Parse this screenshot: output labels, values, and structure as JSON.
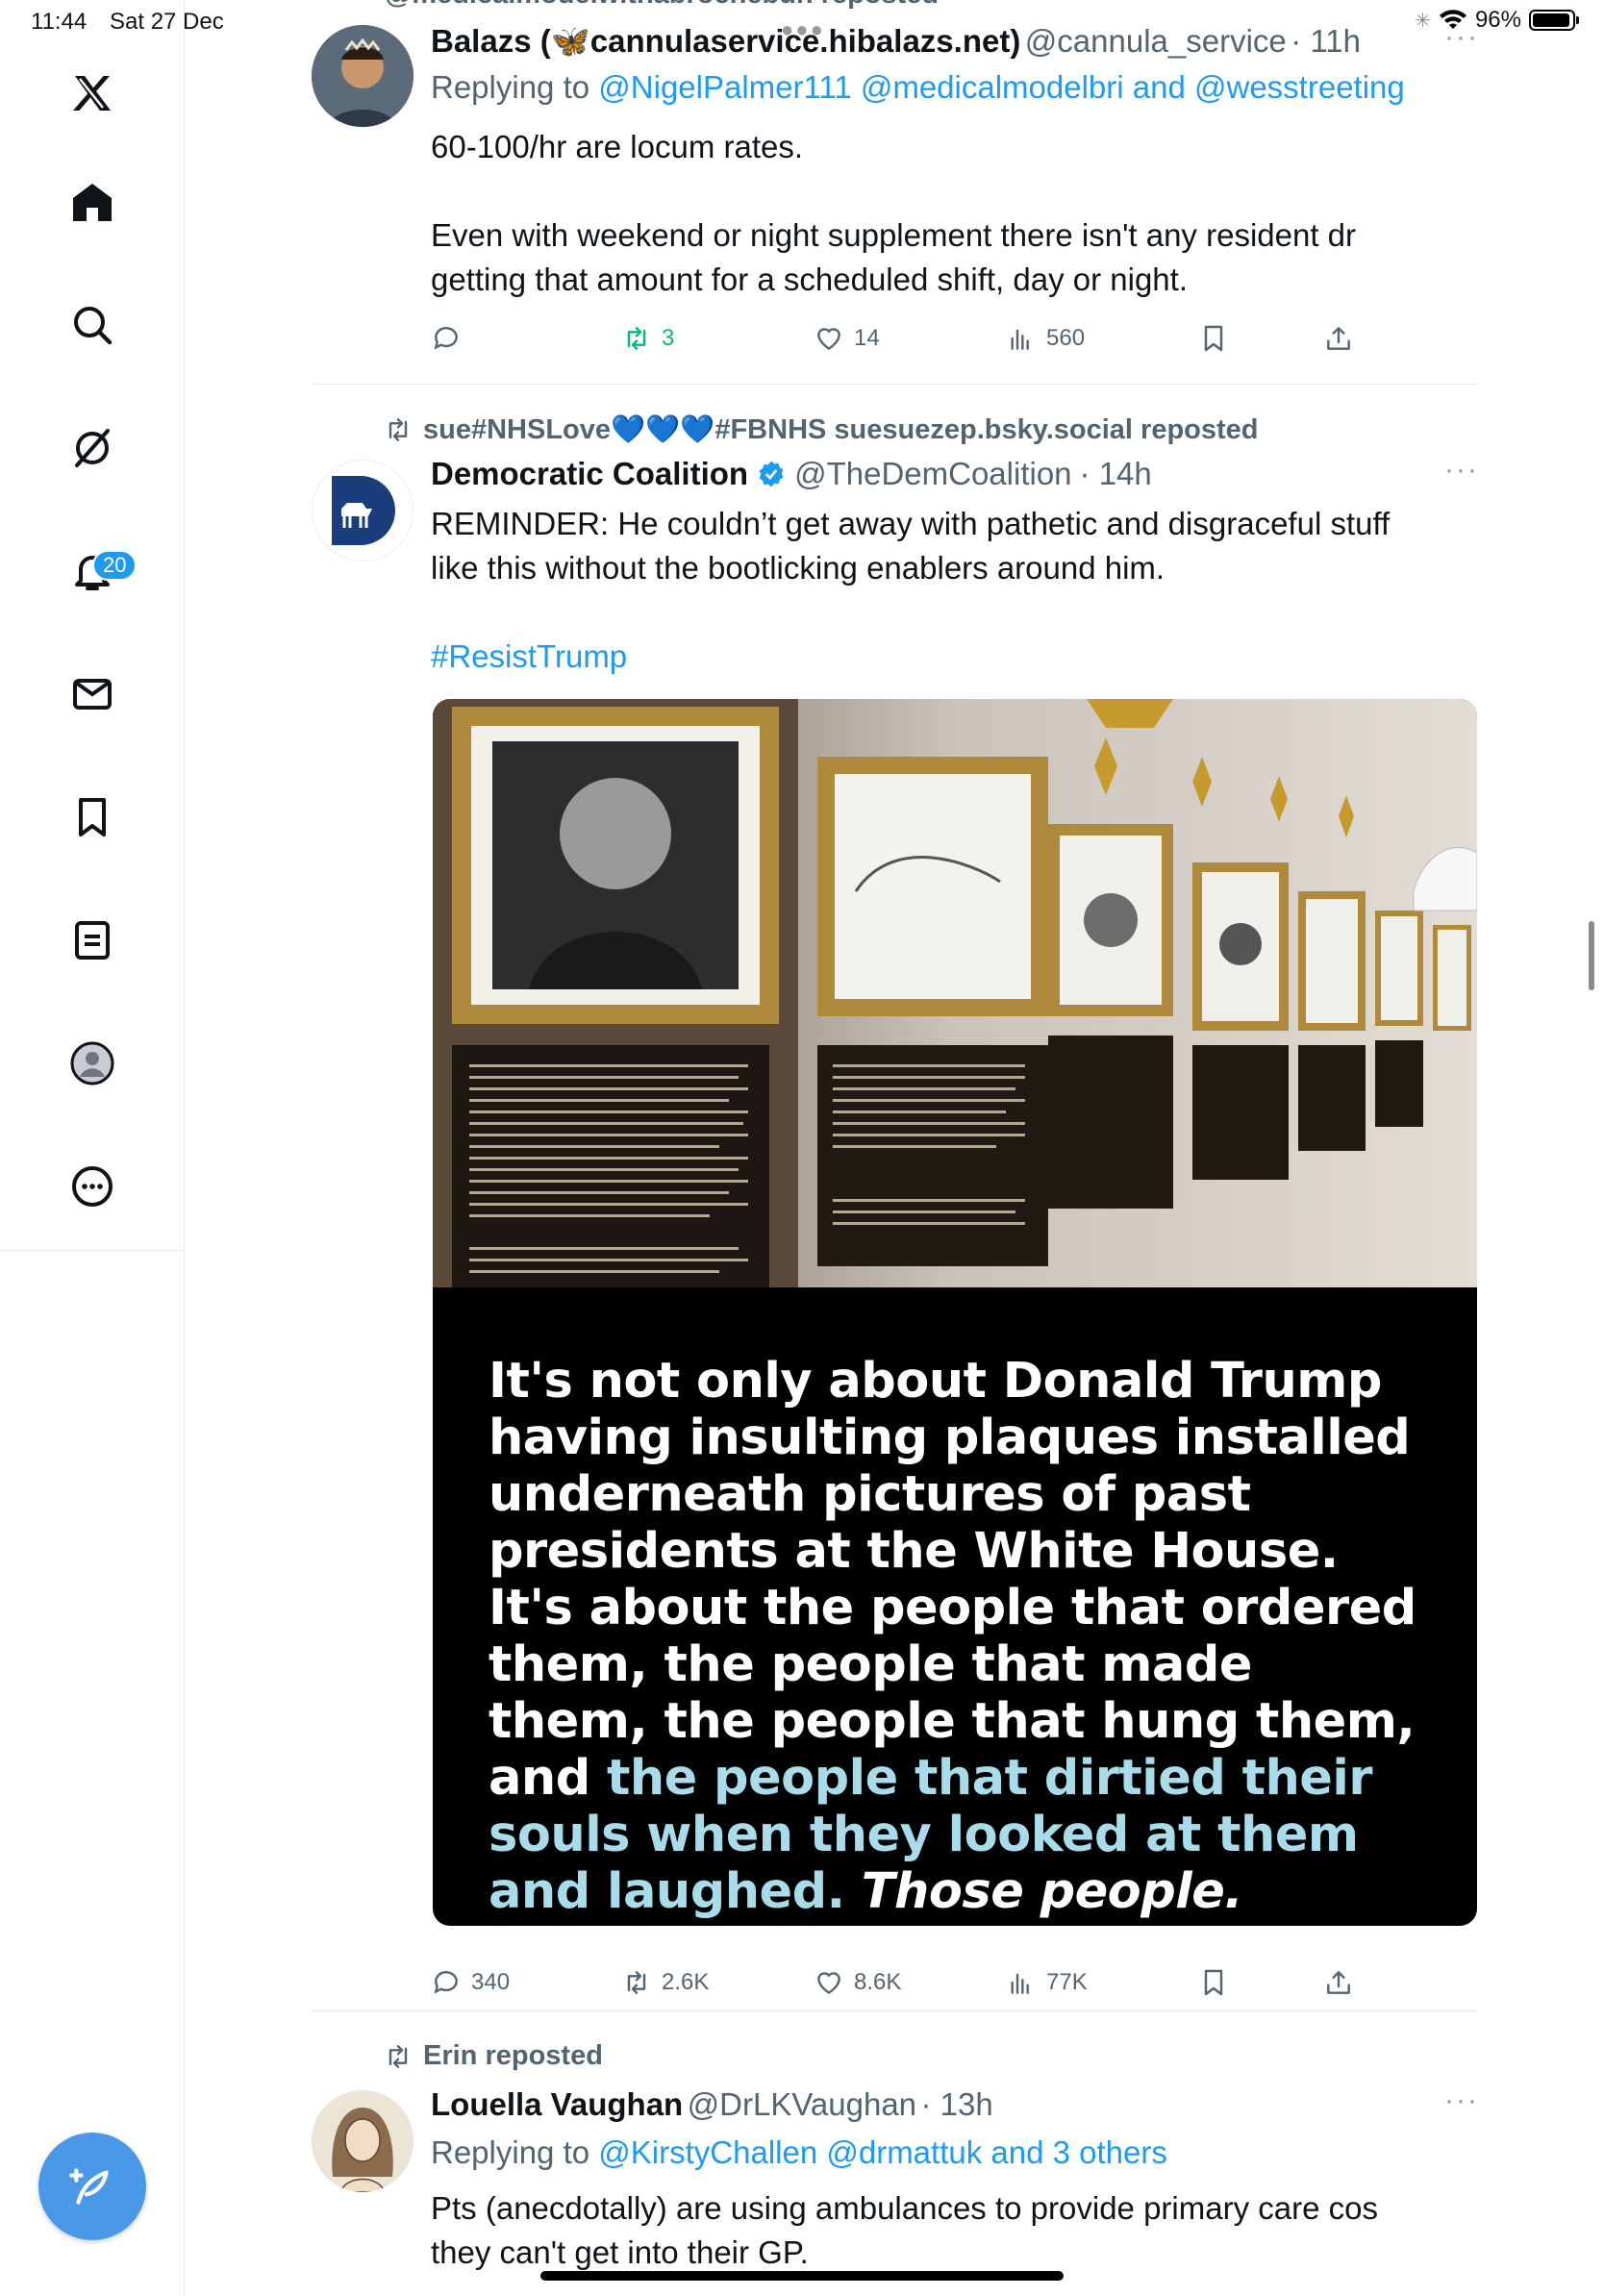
{
  "status_bar": {
    "time": "11:44",
    "date": "Sat 27 Dec",
    "battery": "96%"
  },
  "sidebar": {
    "items": [
      {
        "name": "x-logo"
      },
      {
        "name": "home"
      },
      {
        "name": "search"
      },
      {
        "name": "grok"
      },
      {
        "name": "notifications",
        "badge": "20"
      },
      {
        "name": "messages"
      },
      {
        "name": "bookmarks"
      },
      {
        "name": "lists"
      },
      {
        "name": "profile"
      },
      {
        "name": "more"
      }
    ]
  },
  "top_partial": {
    "text": "@medicalmodelwithabrochebun reposted"
  },
  "tweet1": {
    "name": "Balazs (🦋cannulaservice.hibalazs.net)",
    "handle": "@cannula_service",
    "time": "· 11h",
    "replying_label": "Replying to",
    "replying_to": "@NigelPalmer111 @medicalmodelbri and @wesstreeting",
    "text_line1": "60-100/hr are locum rates.",
    "text_line2": "Even with weekend or night supplement there isn't any resident dr",
    "text_line3": "getting that amount for a scheduled shift, day or night.",
    "retweets": "3",
    "likes": "14",
    "views": "560"
  },
  "tweet2": {
    "repost_by": "sue#NHSLove💙💙💙#FBNHS suesuezep.bsky.social reposted",
    "name": "Democratic Coalition",
    "handle": "@TheDemCoalition",
    "time": "· 14h",
    "text_line1": "REMINDER: He couldn’t get away with pathetic and disgraceful stuff",
    "text_line2": "like this without the bootlicking enablers around him.",
    "hashtag": "#ResistTrump",
    "meme_lines": [
      "It's not only about Donald Trump",
      "having insulting plaques installed",
      "underneath pictures of past",
      "presidents at the White House.",
      "It's about the people that ordered",
      "them, the people that made",
      "them, the people that hung them,"
    ],
    "meme_line8_white": "and ",
    "meme_line8_blue": "the people that dirtied their",
    "meme_line9_blue": "souls when they looked at them",
    "meme_line10_blue": "and laughed.",
    "meme_line10_italic": " Those people.",
    "replies": "340",
    "retweets": "2.6K",
    "likes": "8.6K",
    "views": "77K"
  },
  "tweet3": {
    "repost_by": "Erin reposted",
    "name": "Louella Vaughan",
    "handle": "@DrLKVaughan",
    "time": "· 13h",
    "replying_label": "Replying to",
    "replying_to": "@KirstyChallen @drmattuk and 3 others",
    "text_line1": "Pts (anecdotally) are using ambulances to provide primary care cos",
    "text_line2": "they can't get into their GP."
  },
  "colors": {
    "accent": "#1d9bf0",
    "retweet_green": "#00ba7c",
    "muted": "#536471",
    "compose": "#4a99e9"
  }
}
